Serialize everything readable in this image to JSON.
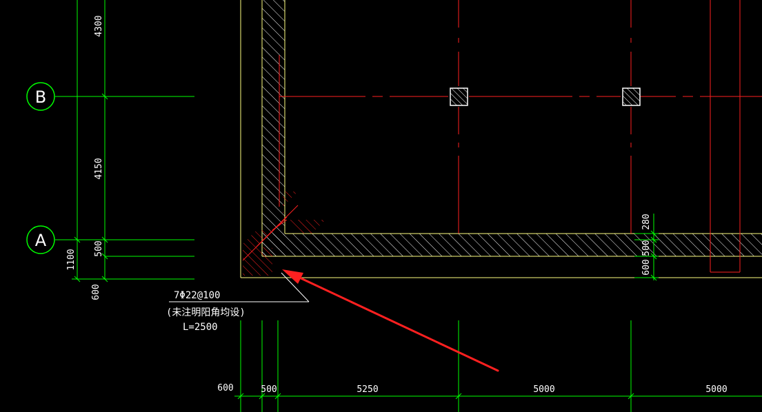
{
  "drawing": {
    "colors": {
      "background": "#000000",
      "dimension_line": "#00ff00",
      "axis_line": "#ff0000",
      "wall_outline": "#ffff80",
      "hatch": "#ffffff",
      "rebar_hatch": "#ff2020",
      "leader": "#ffffff",
      "arrow": "#ff2020",
      "text": "#ffffff"
    },
    "grid_bubbles": [
      {
        "label": "B"
      },
      {
        "label": "A"
      }
    ],
    "left_dimensions": {
      "top": "4300",
      "middle": "4150",
      "lower_inner": "500",
      "lower_outer": "1100",
      "bottom": "600"
    },
    "bottom_dimensions": [
      "600",
      "500",
      "5250",
      "5000",
      "5000"
    ],
    "right_dimensions": {
      "upper": "280",
      "middle": "500",
      "lower": "600"
    },
    "rebar_note": {
      "line1": "7Φ22@100",
      "line2": "(未注明阳角均设)",
      "line3": "L=2500"
    },
    "icons": {
      "column_marker": "hatched-square-icon",
      "pointer": "red-arrow-icon"
    }
  }
}
